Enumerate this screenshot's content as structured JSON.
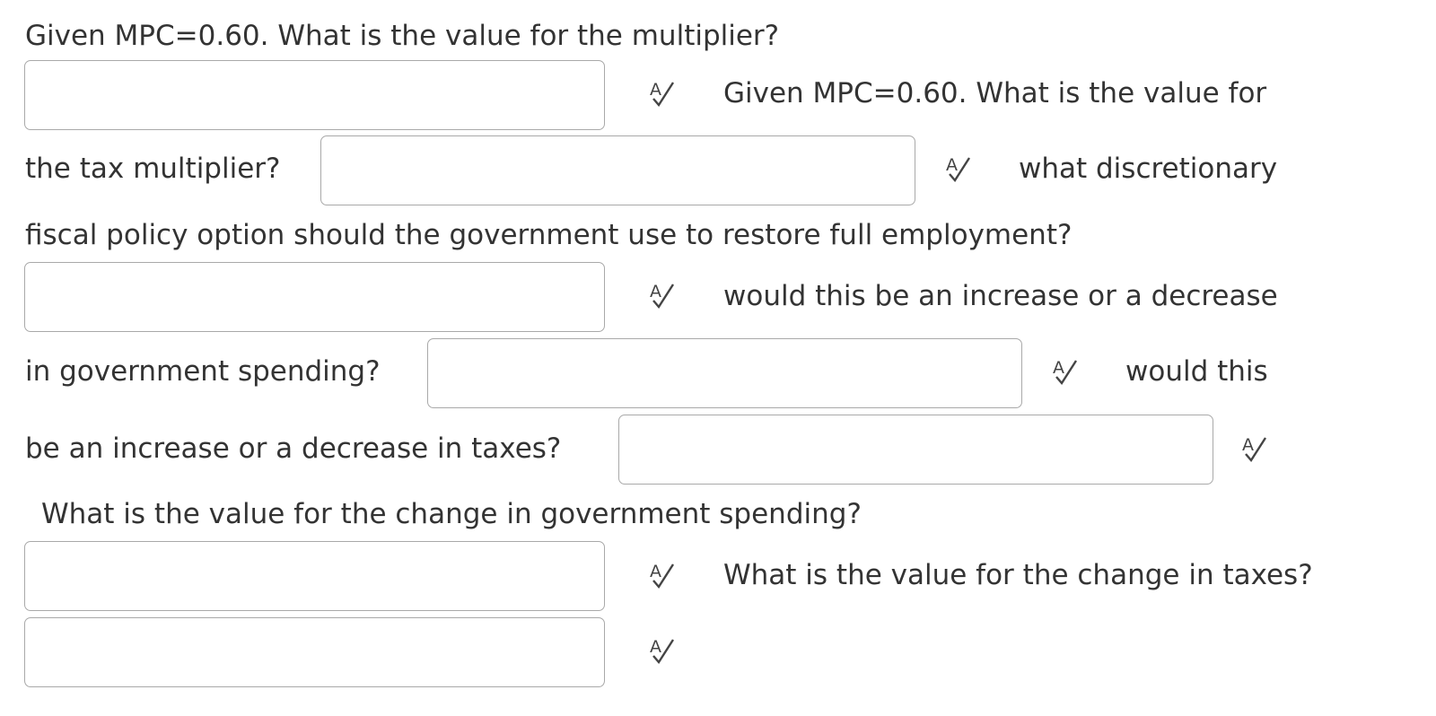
{
  "question": {
    "line1": "Given MPC=0.60. What is the value for the multiplier?",
    "q2_part1": "Given MPC=0.60. What is the value for",
    "q2_part2": "the tax multiplier?",
    "q3_part1": "what discretionary",
    "q3_part2": "fiscal policy option should the government use to restore full employment?",
    "q4_part1": "would this be an increase or a decrease",
    "q4_part2": "in government spending?",
    "q5_part1": "would this",
    "q5_part2": "be an increase or a decrease in taxes?",
    "q6": "What is the value for the change in government spending?",
    "q7": "What is the value for the change in taxes?"
  },
  "answers": {
    "multiplier": "",
    "tax_multiplier": "",
    "fiscal_policy_option": "",
    "government_spending_direction": "",
    "taxes_direction": "",
    "change_in_government_spending": "",
    "change_in_taxes": ""
  },
  "icons": {
    "spell_check": "spell-check-icon"
  }
}
